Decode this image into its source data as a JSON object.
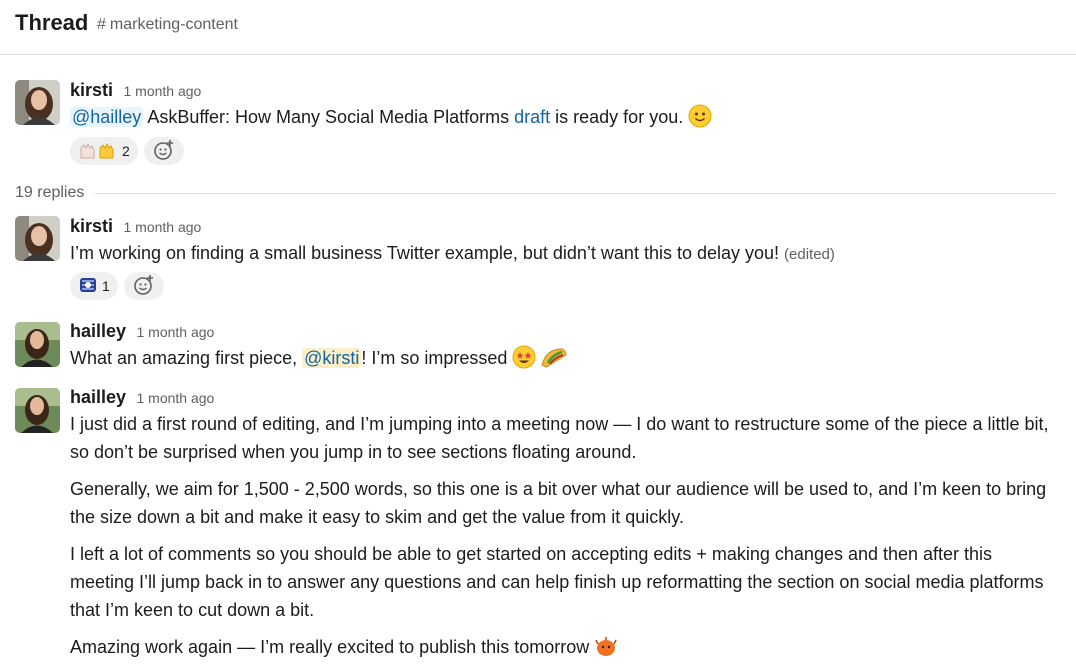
{
  "header": {
    "title": "Thread",
    "channel_hash": "#",
    "channel_name": "marketing-content"
  },
  "messages": [
    {
      "author": "kirsti",
      "time": "1 month ago",
      "mention": "@hailley",
      "text_a": " AskBuffer: How Many Social Media Platforms ",
      "link": "draft",
      "text_b": " is ready for you. ",
      "emoji": "slightly-smiling-face",
      "reactions": [
        {
          "emoji": "raised-hands",
          "count": "2"
        }
      ]
    },
    {
      "author": "kirsti",
      "time": "1 month ago",
      "text": "I’m working on finding a small business Twitter example, but didn’t want this to delay you! ",
      "edited": "(edited)",
      "reactions": [
        {
          "emoji": "custom-badge",
          "count": "1"
        }
      ]
    },
    {
      "author": "hailley",
      "time": "1 month ago",
      "text_a": "What an amazing first piece, ",
      "mention": "@kirsti",
      "text_b": "! I’m so impressed ",
      "emojis": [
        "star-struck",
        "taco"
      ]
    },
    {
      "author": "hailley",
      "time": "1 month ago",
      "paragraphs": [
        "I just did a first round of editing, and I’m jumping into a meeting now — I do want to restructure some of the piece a little bit, so don’t be surprised when you jump in to see sections floating around.",
        "Generally, we aim for 1,500 - 2,500 words, so this one is a bit over what our audience will be used to, and I’m keen to bring the size down a bit and make it easy to skim and get the value from it quickly.",
        "I left a lot of comments so you should be able to get started on accepting edits + making changes and then after this meeting I’ll jump back in to answer any questions and can help finish up reformatting the section on social media platforms that I’m keen to cut down a bit.",
        "Amazing work again — I’m really excited to publish this tomorrow "
      ],
      "trailing_emoji": "orange-blob"
    }
  ],
  "replies_label": "19 replies",
  "colors": {
    "link": "#1264a3",
    "mention_bg": "#e8f5fa",
    "self_mention_bg": "#fcefc8",
    "muted": "#616061"
  }
}
